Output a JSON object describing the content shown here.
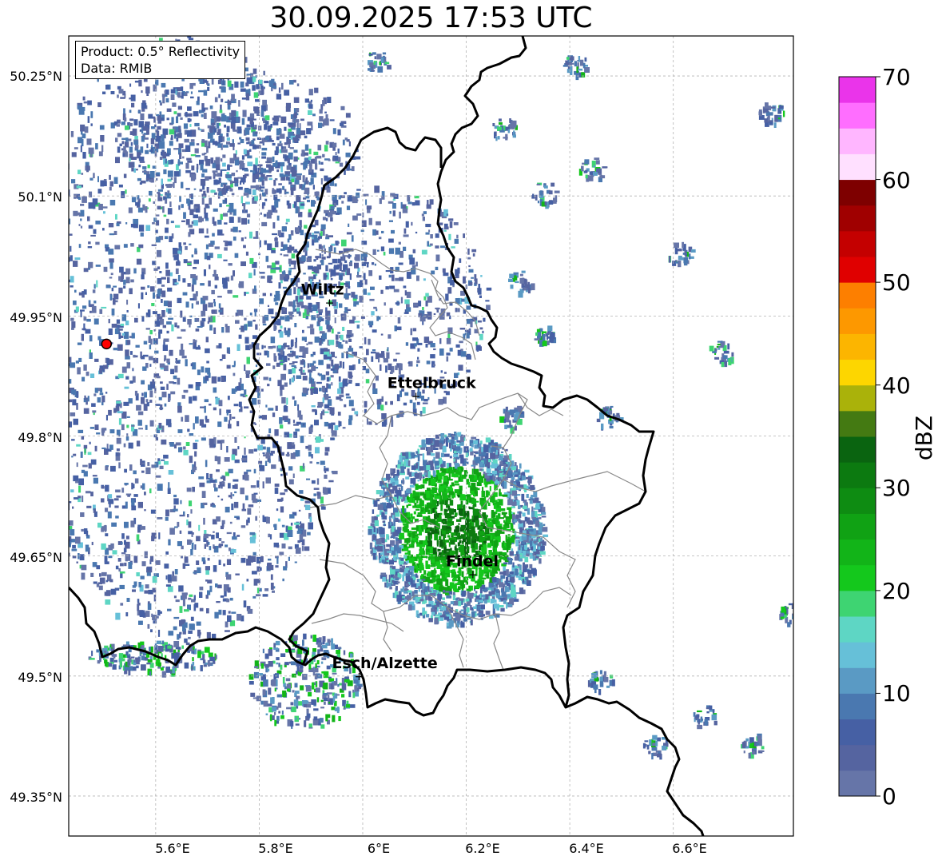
{
  "title": "30.09.2025 17:53 UTC",
  "info": {
    "product": "Product: 0.5° Reflectivity",
    "data_source": "Data: RMIB"
  },
  "axes": {
    "lat_labels": [
      "50.25°N",
      "50.1°N",
      "49.95°N",
      "49.8°N",
      "49.65°N",
      "49.5°N",
      "49.35°N"
    ],
    "lon_labels": [
      "5.6°E",
      "5.8°E",
      "6°E",
      "6.2°E",
      "6.4°E",
      "6.6°E"
    ]
  },
  "cities": [
    {
      "name": "Wiltz",
      "lon": 5.933,
      "lat": 49.967
    },
    {
      "name": "Ettelbruck",
      "lon": 6.1,
      "lat": 49.85
    },
    {
      "name": "Findel",
      "lon": 6.21,
      "lat": 49.627
    },
    {
      "name": "Esch/Alzette",
      "lon": 5.99,
      "lat": 49.5
    }
  ],
  "radar_site": {
    "lon": 5.505,
    "lat": 49.915,
    "color": "#ff0000"
  },
  "colorbar": {
    "label": "dBZ",
    "tick_labels": [
      "70",
      "60",
      "50",
      "40",
      "30",
      "20",
      "10",
      "0"
    ],
    "min": 0,
    "max": 70,
    "colors_bottom_to_top": [
      "#6675a8",
      "#5564a0",
      "#4660a4",
      "#4a78b0",
      "#5a9ac4",
      "#66c0d8",
      "#5ed6c4",
      "#3ed472",
      "#14c81c",
      "#12b418",
      "#10a214",
      "#0e8c12",
      "#0c7a10",
      "#0a6410",
      "#447a12",
      "#aab20a",
      "#fdd600",
      "#fcb500",
      "#fd9800",
      "#fd7f00",
      "#e00000",
      "#c40000",
      "#a00000",
      "#7e0000",
      "#ffe0ff",
      "#ffb6ff",
      "#ff6eff",
      "#ea34ea"
    ]
  },
  "colors": {
    "border": "#000000",
    "canton_border": "#888888",
    "grid": "#b4b4b4"
  }
}
